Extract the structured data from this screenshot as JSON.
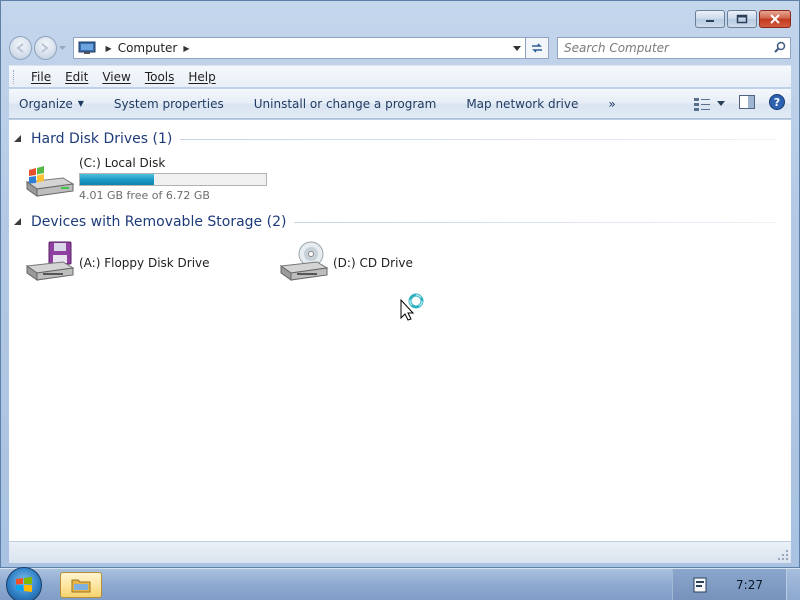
{
  "window": {
    "caption_buttons": [
      "minimize-icon",
      "maximize-icon",
      "close-icon"
    ]
  },
  "address_bar": {
    "location_icon": "computer-icon",
    "path": [
      "Computer"
    ],
    "search_placeholder": "Search Computer"
  },
  "menu": {
    "items": [
      {
        "label": "File",
        "key": "F"
      },
      {
        "label": "Edit",
        "key": "E"
      },
      {
        "label": "View",
        "key": "V"
      },
      {
        "label": "Tools",
        "key": "T"
      },
      {
        "label": "Help",
        "key": "H"
      }
    ]
  },
  "commands": {
    "organize": "Organize",
    "system_properties": "System properties",
    "uninstall": "Uninstall or change a program",
    "map_drive": "Map network drive",
    "more": "»"
  },
  "groups": [
    {
      "title": "Hard Disk Drives (1)",
      "drives": [
        {
          "name": "(C:) Local Disk",
          "free_text": "4.01 GB free of 6.72 GB",
          "used_fraction": 0.4,
          "icon": "windows-drive-icon"
        }
      ]
    },
    {
      "title": "Devices with Removable Storage (2)",
      "drives": [
        {
          "name": "(A:) Floppy Disk Drive",
          "icon": "floppy-drive-icon"
        },
        {
          "name": "(D:) CD Drive",
          "icon": "cd-drive-icon"
        }
      ]
    }
  ],
  "taskbar": {
    "clock": "7:27"
  },
  "colors": {
    "group_title": "#1e3b7a",
    "progress_fill": "#1e9ac4"
  }
}
